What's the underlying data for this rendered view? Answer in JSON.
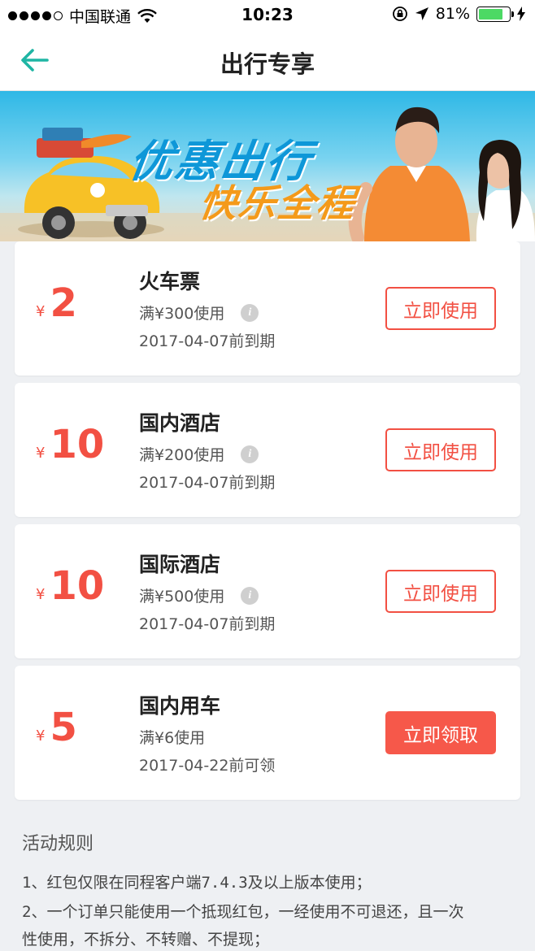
{
  "status_bar": {
    "carrier": "中国联通",
    "time": "10:23",
    "battery_percent": "81%",
    "battery_level": 0.81
  },
  "nav": {
    "title": "出行专享"
  },
  "banner": {
    "line1": "优惠出行",
    "line2": "快乐全程"
  },
  "coupons": [
    {
      "yen": "¥",
      "amount": "2",
      "title": "火车票",
      "condition": "满¥300使用",
      "has_info": true,
      "date": "2017-04-07前到期",
      "button": "立即使用",
      "filled": false
    },
    {
      "yen": "¥",
      "amount": "10",
      "title": "国内酒店",
      "condition": "满¥200使用",
      "has_info": true,
      "date": "2017-04-07前到期",
      "button": "立即使用",
      "filled": false
    },
    {
      "yen": "¥",
      "amount": "10",
      "title": "国际酒店",
      "condition": "满¥500使用",
      "has_info": true,
      "date": "2017-04-07前到期",
      "button": "立即使用",
      "filled": false
    },
    {
      "yen": "¥",
      "amount": "5",
      "title": "国内用车",
      "condition": "满¥6使用",
      "has_info": false,
      "date": "2017-04-22前可领",
      "button": "立即领取",
      "filled": true
    }
  ],
  "rules": {
    "title": "活动规则",
    "lines": [
      "1、红包仅限在同程客户端7.4.3及以上版本使用；",
      "2、一个订单只能使用一个抵现红包，一经使用不可退还，且一次",
      "性使用，不拆分、不转赠、不提现；"
    ]
  },
  "colors": {
    "accent_green": "#1fb5a4",
    "coupon_red": "#f25043"
  }
}
